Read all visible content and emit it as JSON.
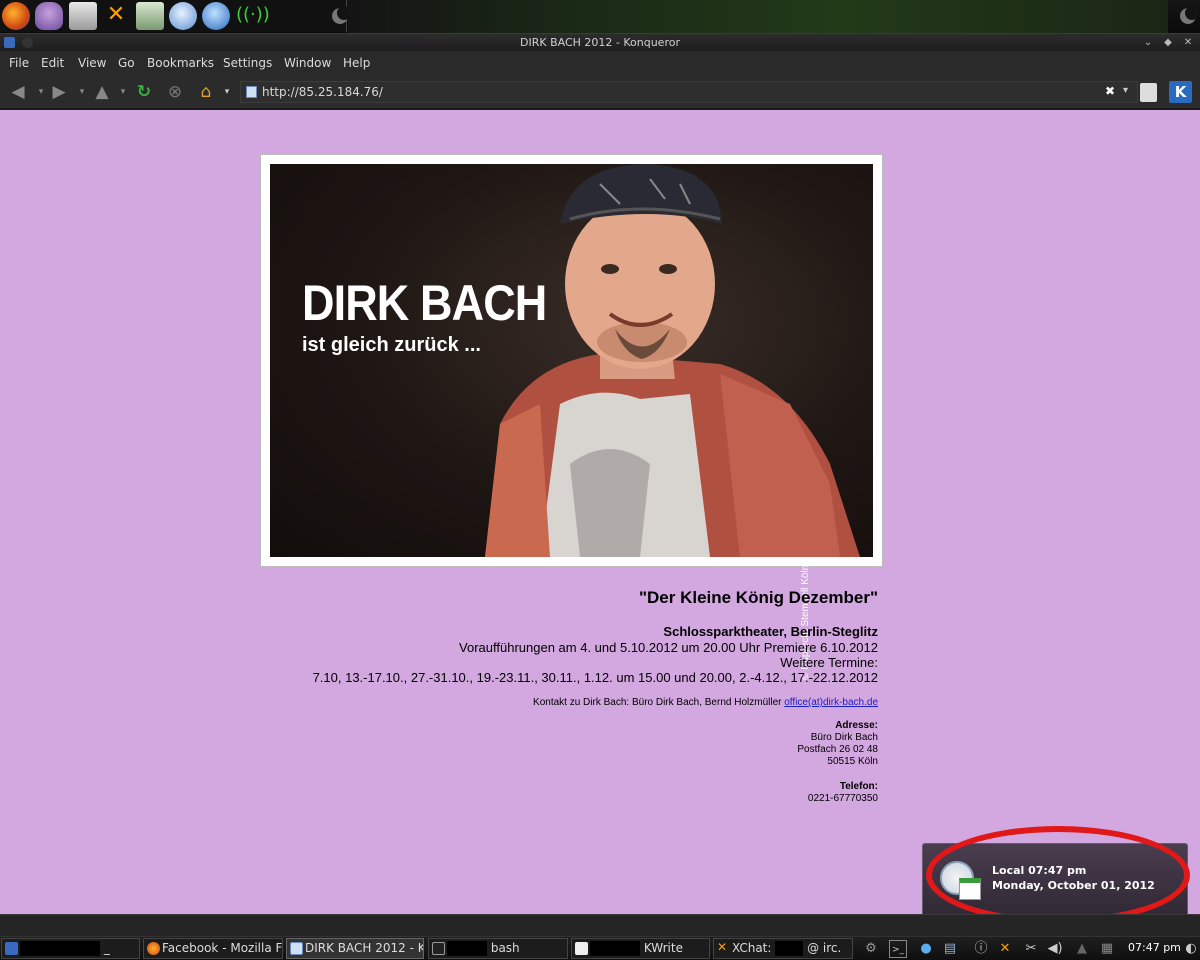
{
  "window": {
    "title": "DIRK BACH 2012 - Konqueror"
  },
  "menu": [
    "File",
    "Edit",
    "View",
    "Go",
    "Bookmarks",
    "Settings",
    "Window",
    "Help"
  ],
  "address": {
    "url": "http://85.25.184.76/"
  },
  "page": {
    "photo_headline": "DIRK BACH",
    "photo_subline": "ist gleich zurück ...",
    "photo_credit": "© Ruprecht Stempell Köln",
    "show_title": "\"Der Kleine König Dezember\"",
    "venue": "Schlossparktheater, Berlin-Steglitz",
    "dates_line1": "Voraufführungen am 4. und 5.10.2012 um 20.00 Uhr Premiere 6.10.2012",
    "dates_line2": "Weitere Termine:",
    "dates_line3": "7.10, 13.-17.10., 27.-31.10., 19.-23.11., 30.11., 1.12. um 15.00 und 20.00, 2.-4.12., 17.-22.12.2012",
    "contact_text": "Kontakt zu Dirk Bach: Büro Dirk Bach, Bernd Holzmüller ",
    "contact_link": "office(at)dirk-bach.de",
    "address_label": "Adresse:",
    "address_lines": [
      "Büro Dirk Bach",
      "Postfach 26 02 48",
      "50515 Köln"
    ],
    "phone_label": "Telefon:",
    "phone": "0221-67770350"
  },
  "clock_popup": {
    "line1": "Local 07:47 pm",
    "line2": "Monday, October 01, 2012"
  },
  "taskbar": {
    "tasks": [
      {
        "label": "_",
        "icon": "konsole-icon"
      },
      {
        "label": "Facebook - Mozilla Fir",
        "icon": "firefox-icon"
      },
      {
        "label": "DIRK BACH 2012 - K",
        "icon": "konqueror-icon"
      },
      {
        "label": "bash",
        "icon": "terminal-icon"
      },
      {
        "label": "KWrite",
        "icon": "kwrite-icon"
      },
      {
        "label": "XChat:",
        "label_suffix": "@ irc.",
        "icon": "xchat-icon"
      }
    ],
    "clock": "07:47 pm"
  },
  "colors": {
    "page_background": "#d3a7e0",
    "link": "#2020c0",
    "annotation_ring": "#e01818"
  }
}
